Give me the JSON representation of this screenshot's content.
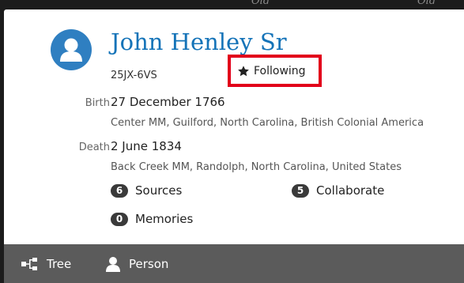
{
  "backdrop": {
    "left_text": "Old",
    "right_text": "Old"
  },
  "person": {
    "name": "John Henley Sr",
    "id": "25JX-6VS",
    "follow_label": "Following"
  },
  "vitals": {
    "birth": {
      "label": "Birth",
      "date": "27 December 1766",
      "place": "Center MM, Guilford, North Carolina, British Colonial America"
    },
    "death": {
      "label": "Death",
      "date": "2 June 1834",
      "place": "Back Creek MM, Randolph, North Carolina, United States"
    }
  },
  "stats": {
    "sources": {
      "count": "6",
      "label": "Sources"
    },
    "collaborate": {
      "count": "5",
      "label": "Collaborate"
    },
    "memories": {
      "count": "0",
      "label": "Memories"
    }
  },
  "footer": {
    "tree_label": "Tree",
    "person_label": "Person"
  },
  "colors": {
    "name_blue": "#1473b8",
    "highlight_red": "#e2001a",
    "footer_gray": "#5b5b5b",
    "avatar_blue": "#2f7fc1"
  },
  "icons": {
    "avatar": "person-silhouette-icon",
    "follow": "star-icon",
    "tree": "tree-icon",
    "person": "person-icon"
  }
}
